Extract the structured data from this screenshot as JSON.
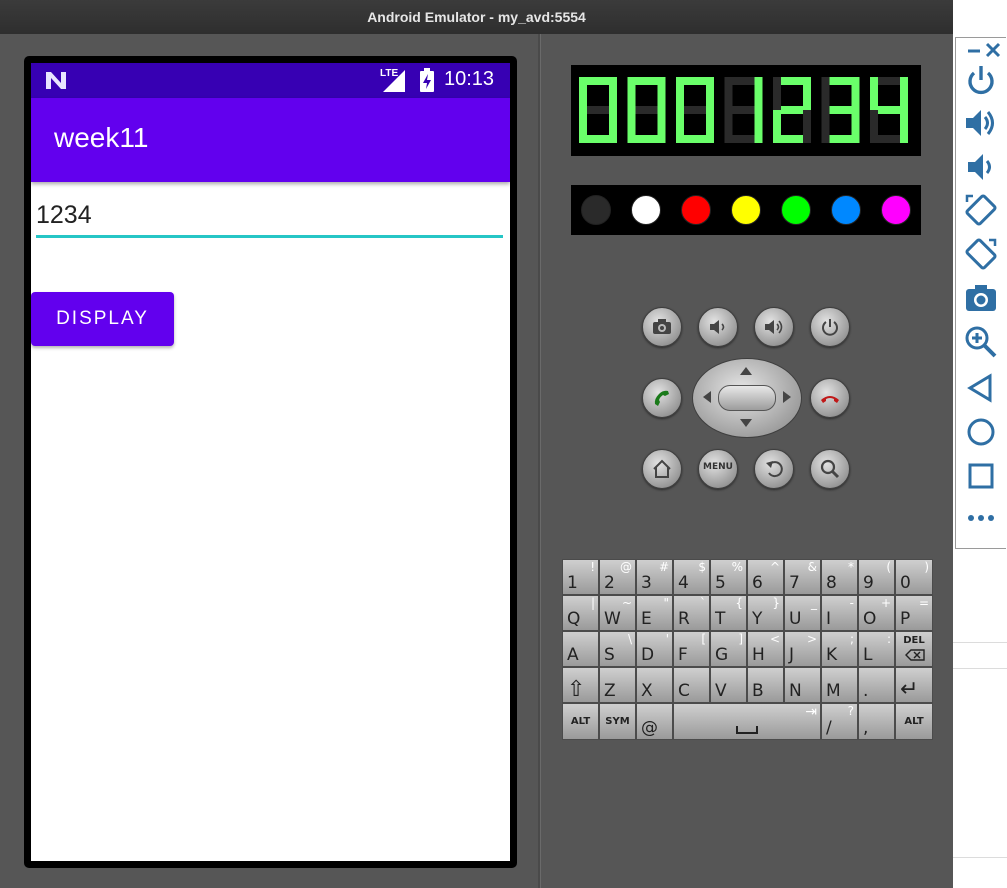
{
  "window": {
    "title": "Android Emulator - my_avd:5554"
  },
  "status_bar": {
    "time": "10:13",
    "network": "LTE"
  },
  "app": {
    "title": "week11",
    "input_value": "1234",
    "button_label": "DISPLAY"
  },
  "lcd": {
    "digits": [
      "0",
      "0",
      "0",
      "1",
      "2",
      "3",
      "4"
    ],
    "color": "#6aff6a"
  },
  "colors": {
    "status_bar": "#3700b3",
    "app_bar": "#6200ee",
    "accent": "#26c6c6",
    "swatches": [
      "#2a2a2a",
      "#ffffff",
      "#ff0000",
      "#ffff00",
      "#00ff00",
      "#0088ff",
      "#ff00ff"
    ]
  },
  "keyboard": {
    "rows": [
      [
        {
          "m": "1",
          "a": "!"
        },
        {
          "m": "2",
          "a": "@"
        },
        {
          "m": "3",
          "a": "#"
        },
        {
          "m": "4",
          "a": "$"
        },
        {
          "m": "5",
          "a": "%"
        },
        {
          "m": "6",
          "a": "^"
        },
        {
          "m": "7",
          "a": "&"
        },
        {
          "m": "8",
          "a": "*"
        },
        {
          "m": "9",
          "a": "("
        },
        {
          "m": "0",
          "a": ")"
        }
      ],
      [
        {
          "m": "Q",
          "a": "|"
        },
        {
          "m": "W",
          "a": "~"
        },
        {
          "m": "E",
          "a": "\""
        },
        {
          "m": "R",
          "a": "`"
        },
        {
          "m": "T",
          "a": "{"
        },
        {
          "m": "Y",
          "a": "}"
        },
        {
          "m": "U",
          "a": "_"
        },
        {
          "m": "I",
          "a": "-"
        },
        {
          "m": "O",
          "a": "+"
        },
        {
          "m": "P",
          "a": "="
        }
      ],
      [
        {
          "m": "A",
          "a": ""
        },
        {
          "m": "S",
          "a": "\\"
        },
        {
          "m": "D",
          "a": "'"
        },
        {
          "m": "F",
          "a": "["
        },
        {
          "m": "G",
          "a": "]"
        },
        {
          "m": "H",
          "a": "<"
        },
        {
          "m": "J",
          "a": ">"
        },
        {
          "m": "K",
          "a": ";"
        },
        {
          "m": "L",
          "a": ":"
        },
        {
          "m": "",
          "a": "",
          "s": "DEL"
        }
      ],
      [
        {
          "m": "⇧",
          "a": ""
        },
        {
          "m": "Z",
          "a": ""
        },
        {
          "m": "X",
          "a": ""
        },
        {
          "m": "C",
          "a": ""
        },
        {
          "m": "V",
          "a": ""
        },
        {
          "m": "B",
          "a": ""
        },
        {
          "m": "N",
          "a": ""
        },
        {
          "m": "M",
          "a": ""
        },
        {
          "m": ".",
          "a": ""
        },
        {
          "m": "↵",
          "a": ""
        }
      ]
    ],
    "bottom": {
      "alt": "ALT",
      "sym": "SYM",
      "at": "@",
      "slash": "/",
      "question": "?",
      "comma": ",",
      "tab": "⇥"
    }
  },
  "controls": {
    "row1": [
      "camera-icon",
      "volume-down-icon",
      "volume-up-icon",
      "power-icon"
    ],
    "row2": [
      "call-icon",
      "dpad",
      "end-call-icon"
    ],
    "row3": [
      "home-icon",
      "menu-button",
      "back-icon",
      "search-icon"
    ],
    "menu_label": "MENU"
  },
  "sidebar": {
    "items": [
      "close-icon",
      "minimize-icon",
      "power-icon",
      "volume-up-icon",
      "volume-down-icon",
      "rotate-left-icon",
      "rotate-right-icon",
      "screenshot-icon",
      "zoom-icon",
      "back-icon",
      "home-icon",
      "overview-icon",
      "more-icon"
    ]
  }
}
